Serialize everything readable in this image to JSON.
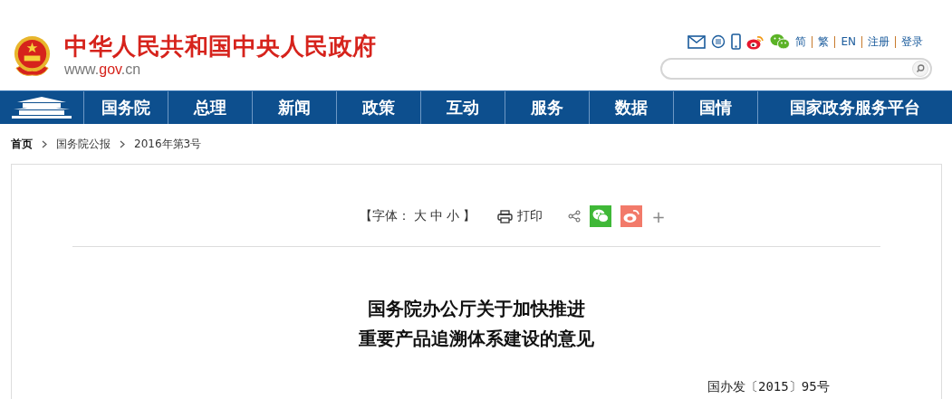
{
  "header": {
    "site_title": "中华人民共和国中央人民政府",
    "site_url_prefix": "www.",
    "site_url_domain": "gov",
    "site_url_suffix": ".cn",
    "links": [
      "简",
      "繁",
      "EN",
      "注册",
      "登录"
    ]
  },
  "nav": {
    "items": [
      "国务院",
      "总理",
      "新闻",
      "政策",
      "互动",
      "服务",
      "数据",
      "国情",
      "国家政务服务平台"
    ]
  },
  "breadcrumb": [
    "首页",
    "国务院公报",
    "2016年第3号"
  ],
  "toolbar": {
    "font_open": "【字体：",
    "font_sizes": [
      "大",
      "中",
      "小"
    ],
    "font_close": "】",
    "print": "打印",
    "more": "+"
  },
  "article": {
    "title_lines": [
      "国务院办公厅关于加快推进",
      "重要产品追溯体系建设的意见"
    ],
    "doc_number": "国办发〔2015〕95号"
  }
}
